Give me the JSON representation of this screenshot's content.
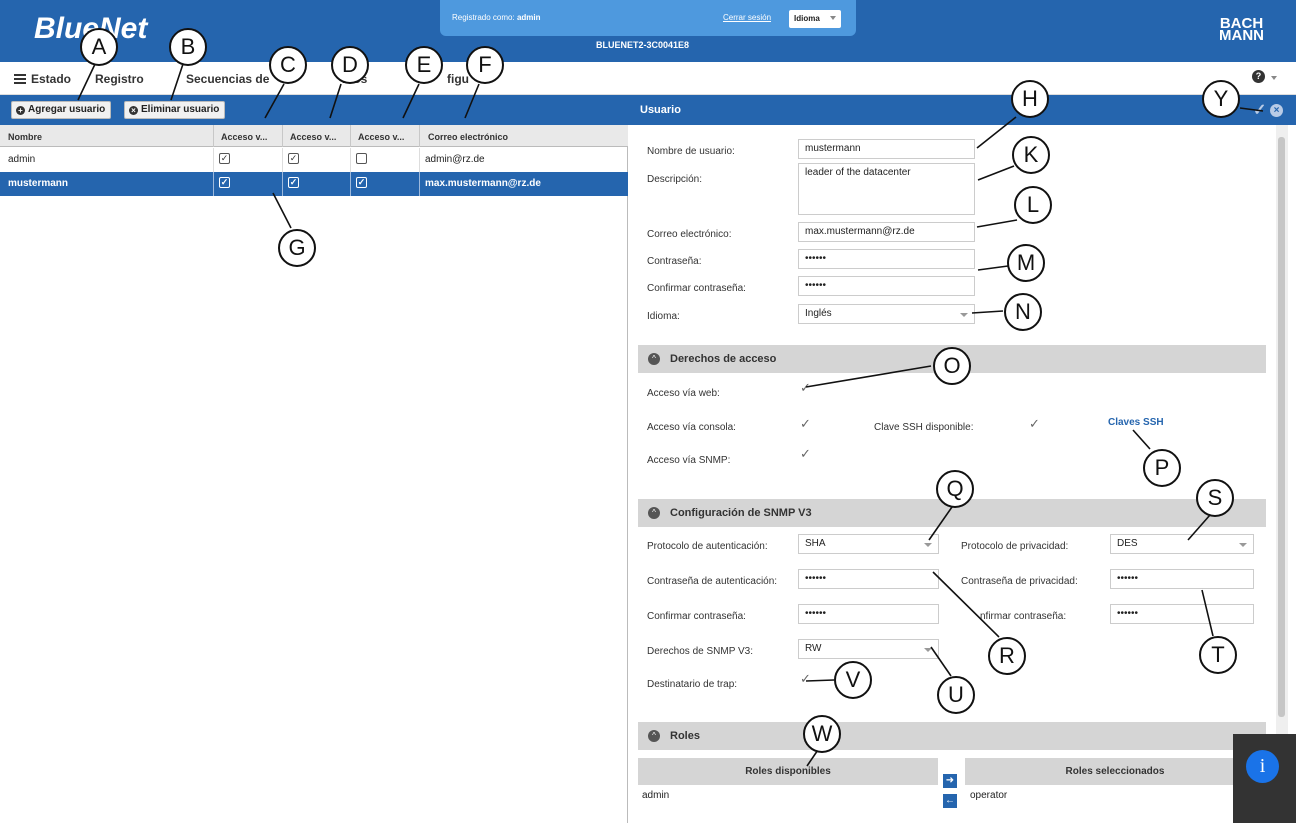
{
  "header": {
    "logo": "BlueNet",
    "brand_line1": "BACH",
    "brand_line2": "MANN",
    "logged_in_label": "Registrado como:",
    "logged_in_user": "admin",
    "logout": "Cerrar sesión",
    "language": "Idioma",
    "device": "BLUENET2-3C0041E8"
  },
  "menu": {
    "items": [
      "Estado",
      "Registro",
      "Secuencias de",
      ".rios",
      "figu"
    ],
    "help": "?"
  },
  "toolbar": {
    "add_user": "Agregar usuario",
    "delete_user": "Eliminar usuario"
  },
  "grid": {
    "columns": [
      "Nombre",
      "Acceso v...",
      "Acceso v...",
      "Acceso v...",
      "Correo electrónico"
    ],
    "rows": [
      {
        "name": "admin",
        "web": true,
        "console": true,
        "snmp": false,
        "email": "admin@rz.de"
      },
      {
        "name": "mustermann",
        "web": true,
        "console": true,
        "snmp": true,
        "email": "max.mustermann@rz.de"
      }
    ]
  },
  "panel": {
    "title": "Usuario",
    "username_label": "Nombre de usuario:",
    "username": "mustermann",
    "description_label": "Descripción:",
    "description": "leader of the datacenter",
    "email_label": "Correo electrónico:",
    "email": "max.mustermann@rz.de",
    "password_label": "Contraseña:",
    "password": "••••••",
    "confirm_label": "Confirmar contraseña:",
    "confirm": "••••••",
    "language_label": "Idioma:",
    "language": "Inglés"
  },
  "access": {
    "title": "Derechos de acceso",
    "web_label": "Acceso vía web:",
    "console_label": "Acceso vía consola:",
    "ssh_key_label": "Clave SSH disponible:",
    "ssh_link": "Claves SSH",
    "snmp_label": "Acceso vía SNMP:"
  },
  "snmp": {
    "title": "Configuración de SNMP V3",
    "auth_proto_label": "Protocolo de autenticación:",
    "auth_proto": "SHA",
    "priv_proto_label": "Protocolo de privacidad:",
    "priv_proto": "DES",
    "auth_pass_label": "Contraseña de autenticación:",
    "auth_pass": "••••••",
    "priv_pass_label": "Contraseña de privacidad:",
    "priv_pass": "••••••",
    "confirm_label": "Confirmar contraseña:",
    "confirm": "••••••",
    "confirm2_label": "nfirmar contraseña:",
    "confirm2": "••••••",
    "rights_label": "Derechos de SNMP V3:",
    "rights": "RW",
    "trap_label": "Destinatario de trap:"
  },
  "roles": {
    "title": "Roles",
    "available_label": "Roles disponibles",
    "selected_label": "Roles seleccionados",
    "available": [
      "admin"
    ],
    "selected": [
      "operator"
    ]
  },
  "callouts": [
    "A",
    "B",
    "C",
    "D",
    "E",
    "F",
    "G",
    "H",
    "K",
    "L",
    "M",
    "N",
    "O",
    "P",
    "Q",
    "R",
    "S",
    "T",
    "U",
    "V",
    "W",
    "Y"
  ],
  "info": "i"
}
